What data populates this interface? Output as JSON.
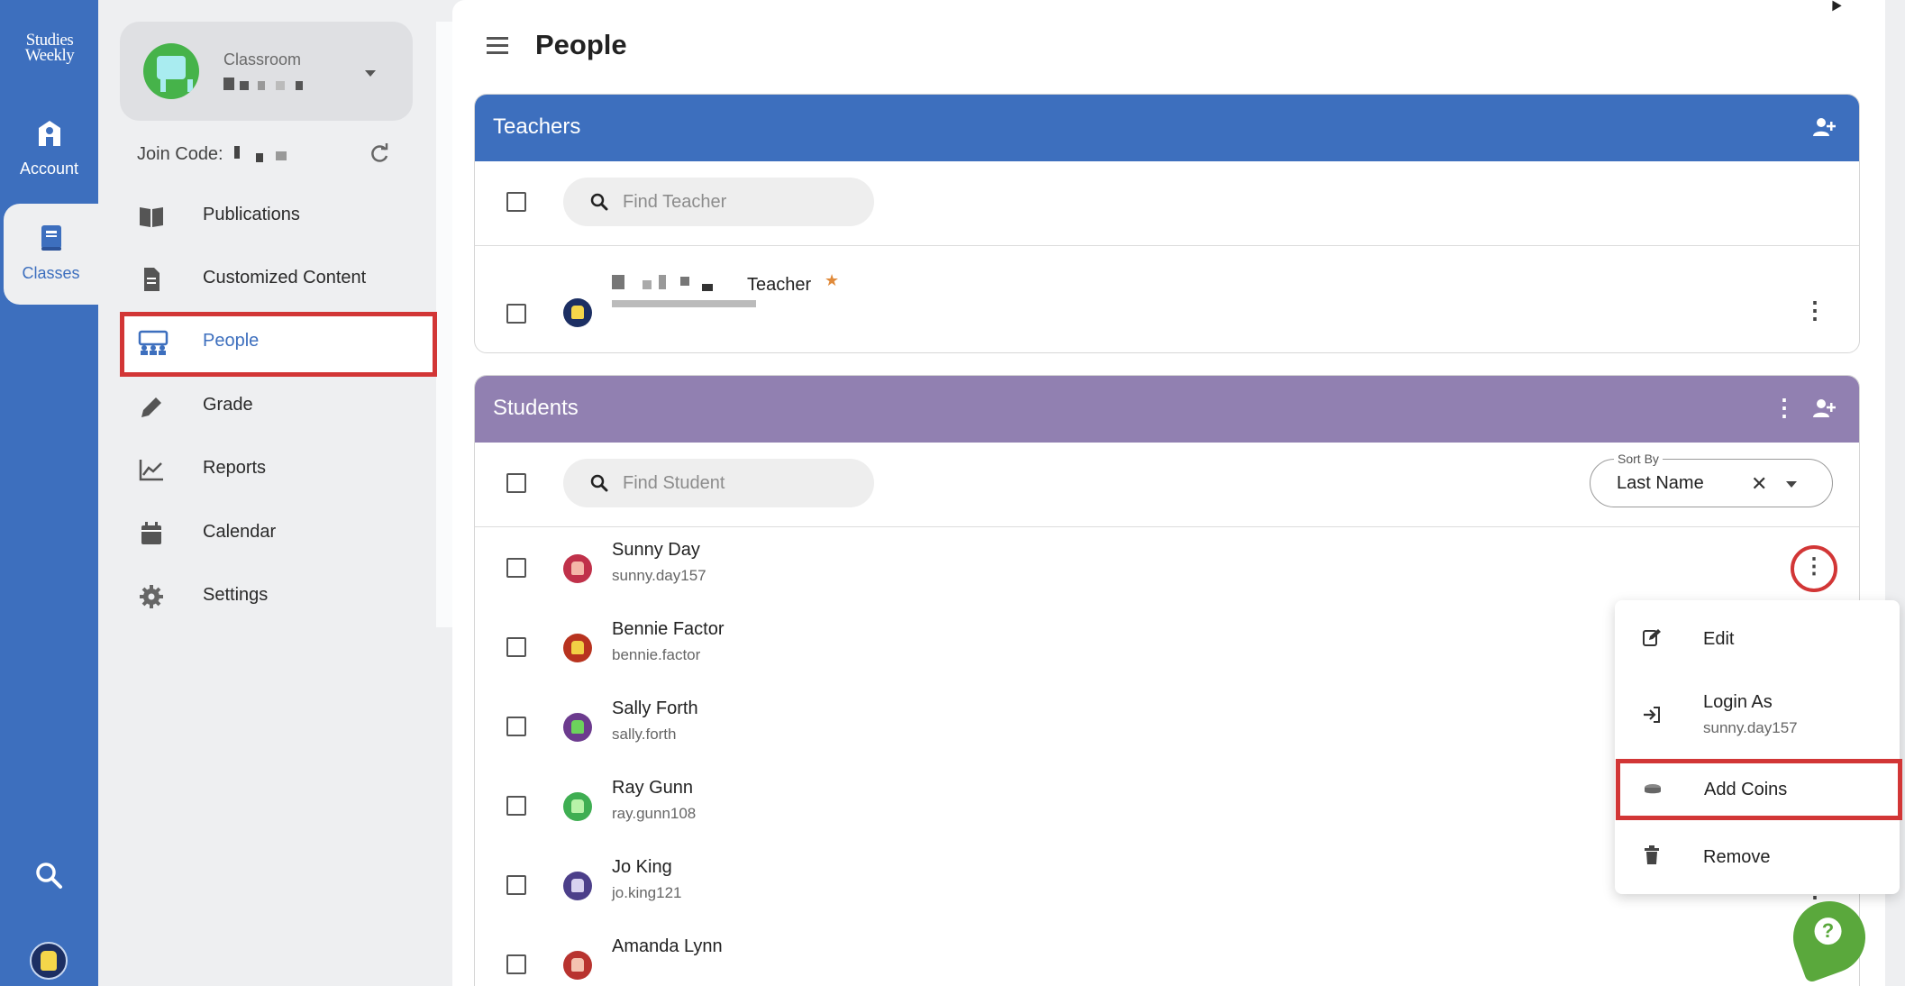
{
  "brand": {
    "logo_line1": "Studies",
    "logo_line2": "Weekly",
    "accent": "#3d6fbe",
    "student_header_color": "#9180b1",
    "highlight": "#d23636"
  },
  "rail": {
    "items": [
      {
        "label": "Account",
        "icon": "account-icon"
      },
      {
        "label": "Classes",
        "icon": "book-icon",
        "active": true
      }
    ],
    "bottom": [
      {
        "icon": "search-icon"
      },
      {
        "icon": "user-avatar-icon"
      }
    ]
  },
  "sidebar": {
    "class_label": "Classroom",
    "join_label": "Join Code:",
    "items": [
      {
        "label": "Publications",
        "icon": "book-open-icon"
      },
      {
        "label": "Customized Content",
        "icon": "document-icon"
      },
      {
        "label": "People",
        "icon": "people-icon",
        "active": true
      },
      {
        "label": "Grade",
        "icon": "pen-icon"
      },
      {
        "label": "Reports",
        "icon": "chart-icon"
      },
      {
        "label": "Calendar",
        "icon": "calendar-icon"
      },
      {
        "label": "Settings",
        "icon": "gear-icon"
      }
    ]
  },
  "header": {
    "title": "People"
  },
  "teachers": {
    "title": "Teachers",
    "search_placeholder": "Find Teacher",
    "rows": [
      {
        "role": "Teacher",
        "owner": true
      }
    ]
  },
  "students": {
    "title": "Students",
    "search_placeholder": "Find Student",
    "sort": {
      "label": "Sort By",
      "value": "Last Name"
    },
    "rows": [
      {
        "name": "Sunny Day",
        "username": "sunny.day157",
        "avatar_bg": "#c0314a",
        "avatar_fg": "#f4b6a8"
      },
      {
        "name": "Bennie Factor",
        "username": "bennie.factor",
        "avatar_bg": "#b8331f",
        "avatar_fg": "#f2d045"
      },
      {
        "name": "Sally Forth",
        "username": "sally.forth",
        "avatar_bg": "#6c3b8e",
        "avatar_fg": "#6cd35c"
      },
      {
        "name": "Ray Gunn",
        "username": "ray.gunn108",
        "avatar_bg": "#3fae52",
        "avatar_fg": "#b8f2a8"
      },
      {
        "name": "Jo King",
        "username": "jo.king121",
        "avatar_bg": "#4c3f8a",
        "avatar_fg": "#d8d2f0"
      },
      {
        "name": "Amanda Lynn",
        "username": "",
        "avatar_bg": "#b8332f",
        "avatar_fg": "#f4c2b0"
      }
    ]
  },
  "row_menu": {
    "items": [
      {
        "label": "Edit",
        "icon": "edit-icon"
      },
      {
        "label": "Login As",
        "sub": "sunny.day157",
        "icon": "login-icon"
      },
      {
        "label": "Add Coins",
        "icon": "coins-icon",
        "highlighted": true
      },
      {
        "label": "Remove",
        "icon": "trash-icon"
      }
    ]
  },
  "help": {
    "glyph": "?"
  }
}
